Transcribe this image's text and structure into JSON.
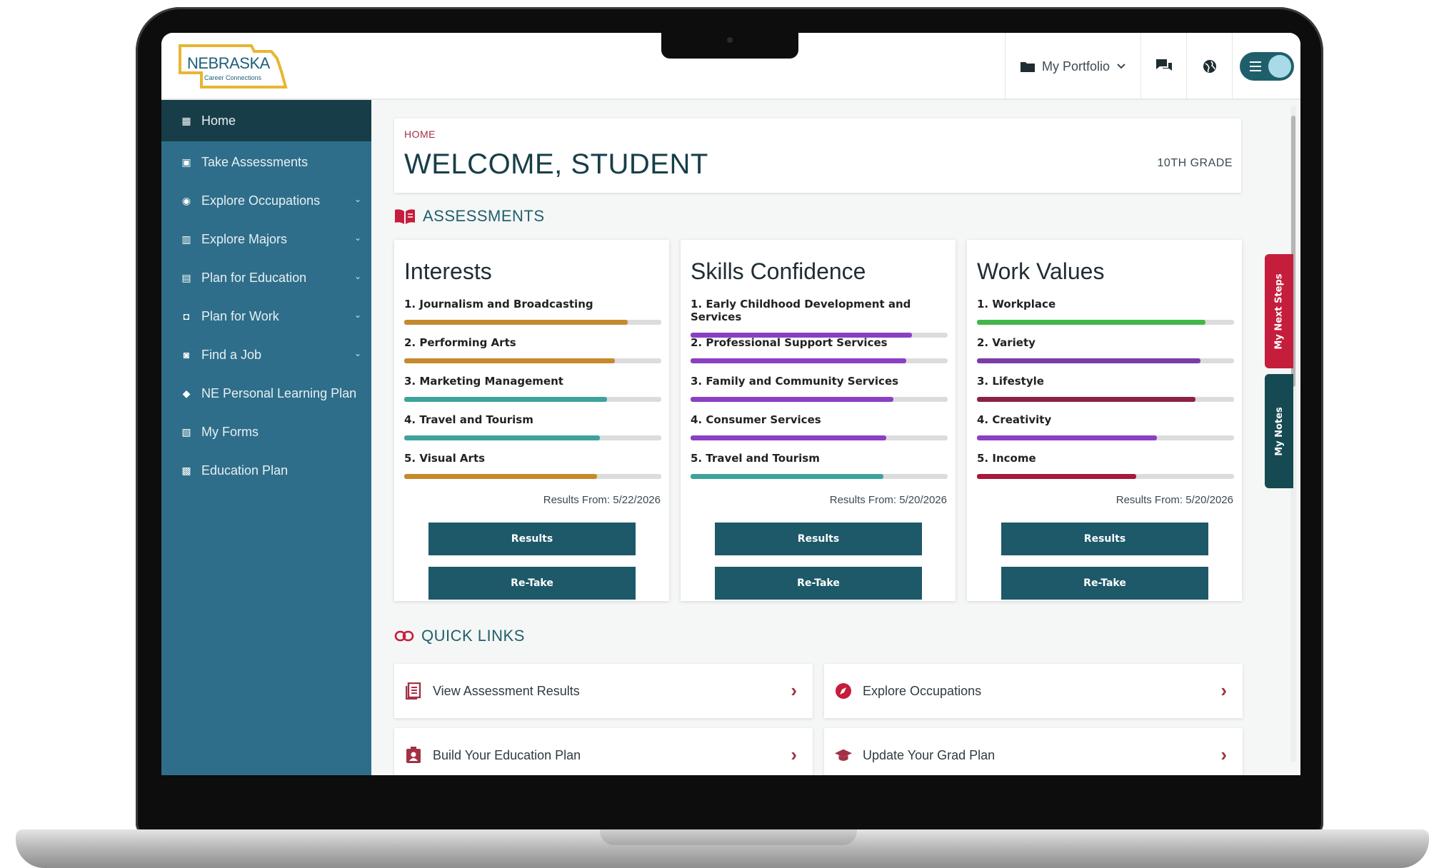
{
  "app": {
    "logo_text": "NEBRASKA",
    "logo_subtext": "Career Connections"
  },
  "header": {
    "portfolio_label": "My Portfolio"
  },
  "sidebar": {
    "items": [
      {
        "label": "Home",
        "icon": "home-icon",
        "active": true,
        "has_chevron": false
      },
      {
        "label": "Take Assessments",
        "icon": "clipboard-icon",
        "has_chevron": false
      },
      {
        "label": "Explore Occupations",
        "icon": "compass-icon",
        "has_chevron": true
      },
      {
        "label": "Explore Majors",
        "icon": "book-icon",
        "has_chevron": true
      },
      {
        "label": "Plan for Education",
        "icon": "id-badge-icon",
        "has_chevron": true
      },
      {
        "label": "Plan for Work",
        "icon": "briefcase-icon",
        "has_chevron": true
      },
      {
        "label": "Find a Job",
        "icon": "toolbox-icon",
        "has_chevron": true
      },
      {
        "label": "NE Personal Learning Plan",
        "icon": "graduation-cap-icon",
        "has_chevron": false
      },
      {
        "label": "My Forms",
        "icon": "forms-icon",
        "has_chevron": false
      },
      {
        "label": "Education Plan",
        "icon": "calendar-icon",
        "has_chevron": false
      }
    ]
  },
  "welcome": {
    "breadcrumb": "HOME",
    "title": "WELCOME, STUDENT",
    "grade": "10TH GRADE"
  },
  "assessments": {
    "heading": "ASSESSMENTS",
    "cards": [
      {
        "title": "Interests",
        "results_from": "Results From: 5/22/2026",
        "results_label": "Results",
        "retake_label": "Re-Take",
        "items": [
          {
            "label": "1. Journalism and Broadcasting",
            "value": 0.87,
            "color": "#c58a2c"
          },
          {
            "label": "2. Performing Arts",
            "value": 0.82,
            "color": "#c58a2c"
          },
          {
            "label": "3. Marketing Management",
            "value": 0.79,
            "color": "#3ea39a"
          },
          {
            "label": "4. Travel and Tourism",
            "value": 0.76,
            "color": "#3ea39a"
          },
          {
            "label": "5. Visual Arts",
            "value": 0.75,
            "color": "#c58a2c"
          }
        ]
      },
      {
        "title": "Skills Confidence",
        "results_from": "Results From: 5/20/2026",
        "results_label": "Results",
        "retake_label": "Re-Take",
        "items": [
          {
            "label": "1. Early Childhood Development and Services",
            "value": 0.86,
            "color": "#8a3fc4"
          },
          {
            "label": "2. Professional Support Services",
            "value": 0.84,
            "color": "#8a3fc4"
          },
          {
            "label": "3. Family and Community Services",
            "value": 0.79,
            "color": "#8a3fc4"
          },
          {
            "label": "4. Consumer Services",
            "value": 0.76,
            "color": "#8a3fc4"
          },
          {
            "label": "5. Travel and Tourism",
            "value": 0.75,
            "color": "#3ea39a"
          }
        ]
      },
      {
        "title": "Work Values",
        "results_from": "Results From: 5/20/2026",
        "results_label": "Results",
        "retake_label": "Re-Take",
        "items": [
          {
            "label": "1. Workplace",
            "value": 0.89,
            "color": "#43b649"
          },
          {
            "label": "2. Variety",
            "value": 0.87,
            "color": "#7a3da8"
          },
          {
            "label": "3. Lifestyle",
            "value": 0.85,
            "color": "#8a2246"
          },
          {
            "label": "4. Creativity",
            "value": 0.7,
            "color": "#8a3fc4"
          },
          {
            "label": "5. Income",
            "value": 0.62,
            "color": "#a8173a"
          }
        ]
      }
    ]
  },
  "quick_links": {
    "heading": "QUICK LINKS",
    "items": [
      {
        "label": "View Assessment Results",
        "icon": "document-list-icon"
      },
      {
        "label": "Explore Occupations",
        "icon": "compass-icon"
      },
      {
        "label": "Build Your Education Plan",
        "icon": "id-badge-icon"
      },
      {
        "label": "Update Your Grad Plan",
        "icon": "graduation-cap-icon"
      }
    ]
  },
  "side_tabs": {
    "next_steps": "My Next Steps",
    "notes": "My Notes"
  },
  "colors": {
    "sidebar": "#2f6e8a",
    "sidebar_active": "#173e48",
    "button": "#1d5968",
    "accent_red": "#a33146",
    "next_steps_tab": "#c51d3c",
    "notes_tab": "#154a52"
  }
}
